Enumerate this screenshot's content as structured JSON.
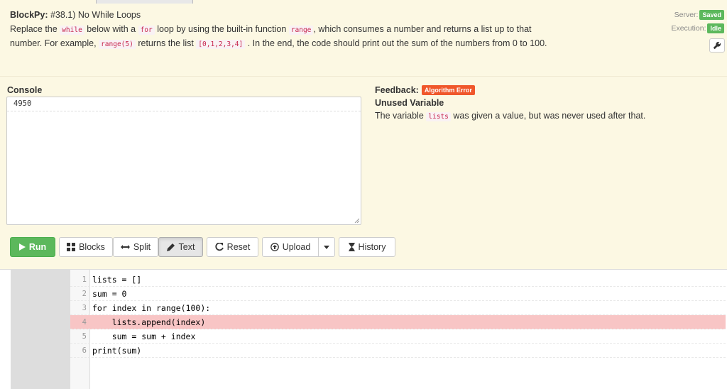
{
  "header": {
    "app_name": "BlockPy:",
    "problem_title": "#38.1) No While Loops",
    "desc_part1": "Replace the",
    "code_while": "while",
    "desc_part2": "below with a",
    "code_for": "for",
    "desc_part3": "loop by using the built-in function",
    "code_range": "range",
    "desc_part4": ", which consumes a number and returns a list up to that number. For example,",
    "code_range5": "range(5)",
    "desc_part5": "returns the list",
    "code_list": "[0,1,2,3,4]",
    "desc_part6": ". In the end, the code should print out the sum of the numbers from 0 to 100."
  },
  "status": {
    "server_label": "Server:",
    "server_value": "Saved",
    "execution_label": "Execution:",
    "execution_value": "Idle"
  },
  "console": {
    "label": "Console",
    "lines": [
      "4950"
    ]
  },
  "feedback": {
    "label": "Feedback:",
    "badge": "Algorithm Error",
    "title": "Unused Variable",
    "msg_part1": "The variable",
    "msg_code": "lists",
    "msg_part2": "was given a value, but was never used after that."
  },
  "toolbar": {
    "run": "Run",
    "blocks": "Blocks",
    "split": "Split",
    "text": "Text",
    "reset": "Reset",
    "upload": "Upload",
    "history": "History"
  },
  "editor": {
    "line_numbers": [
      "1",
      "2",
      "3",
      "4",
      "5",
      "6"
    ],
    "lines": [
      "lists = []",
      "sum = 0",
      "for index in range(100):",
      "    lists.append(index)",
      "    sum = sum + index",
      "print(sum)"
    ],
    "error_line": 4
  },
  "colors": {
    "background": "#fcf8e3",
    "run_green": "#5cb85c",
    "error_red": "#f0572b",
    "error_line": "#f8c5c5"
  }
}
